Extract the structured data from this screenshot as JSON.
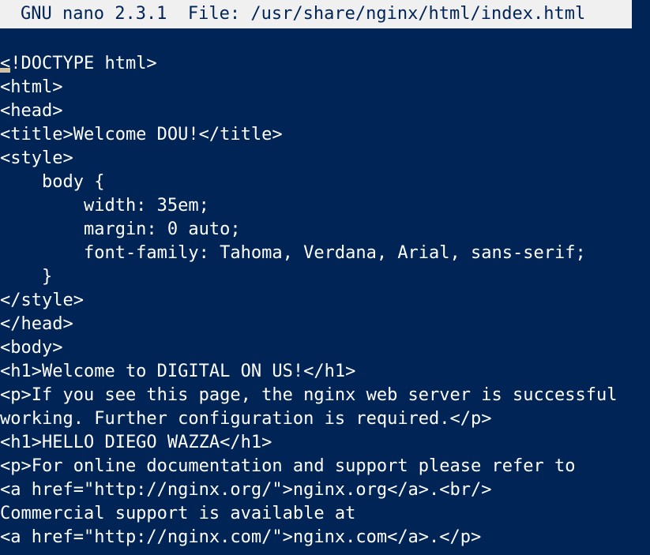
{
  "title_bar": {
    "text": "GNU nano 2.3.1  File: /usr/share/nginx/html/index.html"
  },
  "editor": {
    "cursor_char": "<",
    "first_line_rest": "!DOCTYPE html>",
    "lines": [
      "<html>",
      "<head>",
      "<title>Welcome DOU!</title>",
      "<style>",
      "    body {",
      "        width: 35em;",
      "        margin: 0 auto;",
      "        font-family: Tahoma, Verdana, Arial, sans-serif;",
      "    }",
      "</style>",
      "</head>",
      "<body>",
      "<h1>Welcome to DIGITAL ON US!</h1>",
      "<p>If you see this page, the nginx web server is successful",
      "working. Further configuration is required.</p>",
      "<h1>HELLO DIEGO WAZZA</h1>",
      "<p>For online documentation and support please refer to",
      "<a href=\"http://nginx.org/\">nginx.org</a>.<br/>",
      "Commercial support is available at",
      "<a href=\"http://nginx.com/\">nginx.com</a>.</p>"
    ]
  },
  "colors": {
    "background": "#012456",
    "title_bar_bg": "#f0f0f0",
    "text": "#ffffff",
    "cursor": "#f5deb3"
  }
}
